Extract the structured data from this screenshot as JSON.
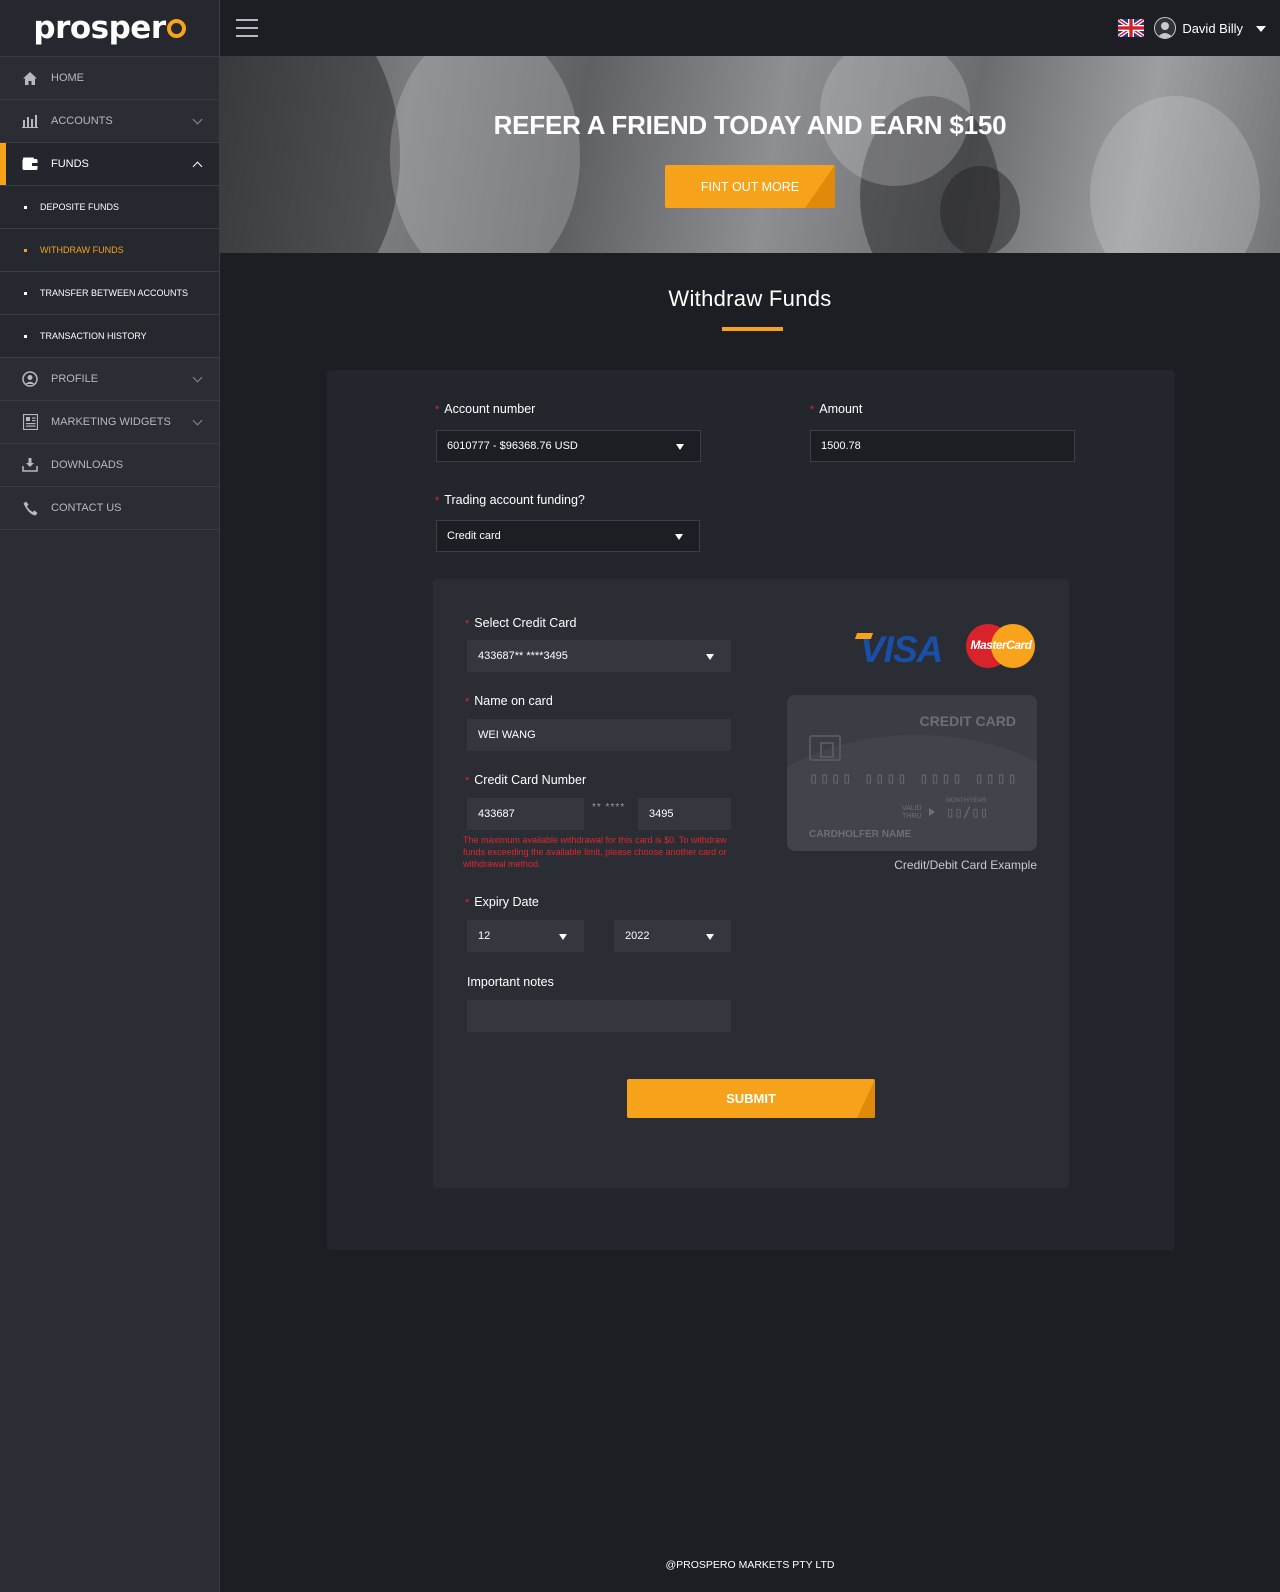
{
  "brand": {
    "logo_text": "prosper"
  },
  "sidebar": {
    "items": [
      {
        "label": "HOME",
        "icon": "home-icon"
      },
      {
        "label": "ACCOUNTS",
        "icon": "bar-chart-icon"
      },
      {
        "label": "FUNDS",
        "icon": "wallet-icon"
      },
      {
        "label": "PROFILE",
        "icon": "user-icon"
      },
      {
        "label": "MARKETING WIDGETS",
        "icon": "widgets-icon"
      },
      {
        "label": "DOWNLOADS",
        "icon": "download-icon"
      },
      {
        "label": "CONTACT US",
        "icon": "phone-icon"
      }
    ],
    "funds_sub": [
      {
        "label": "DEPOSITE FUNDS"
      },
      {
        "label": "WITHDRAW FUNDS"
      },
      {
        "label": "TRANSFER BETWEEN ACCOUNTS"
      },
      {
        "label": "TRANSACTION HISTORY"
      }
    ]
  },
  "topbar": {
    "username": "David Billy",
    "language": "uk-flag-icon"
  },
  "banner": {
    "title": "REFER A FRIEND TODAY AND EARN $150",
    "button": "FINT OUT MORE"
  },
  "page": {
    "title": "Withdraw Funds"
  },
  "form": {
    "account_number": {
      "label": "Account number",
      "value": "6010777 - $96368.76 USD"
    },
    "amount": {
      "label": "Amount",
      "value": "1500.78"
    },
    "funding": {
      "label": "Trading account funding?",
      "value": "Credit card"
    },
    "select_card": {
      "label": "Select Credit Card",
      "value": "433687** ****3495"
    },
    "name_on_card": {
      "label": "Name on card",
      "value": "WEI WANG"
    },
    "card_number": {
      "label": "Credit Card Number",
      "first": "433687",
      "middle": "** ****",
      "last": "3495"
    },
    "error": "The maximum available withdrawal for this card is $0. To withdraw funds exceeding the available limit, please choose another card or withdrawal method.",
    "expiry": {
      "label": "Expiry Date",
      "month": "12",
      "year": "2022"
    },
    "notes": {
      "label": "Important notes",
      "value": ""
    },
    "submit": "SUBMIT"
  },
  "card_example": {
    "logos": {
      "visa": "VISA",
      "mastercard": "MasterCard"
    },
    "title": "CREDIT CARD",
    "number": "▯▯▯▯ ▯▯▯▯ ▯▯▯▯ ▯▯▯▯",
    "valid_thru": "VALID THRU",
    "month_year": "MONTH/YEAR",
    "expiry": "▯▯/▯▯",
    "holder": "CARDHOLFER NAME",
    "caption": "Credit/Debit Card Example"
  },
  "footer": {
    "text": "@PROSPERO MARKETS PTY LTD"
  },
  "colors": {
    "accent": "#f7a21b",
    "error": "#e0262d",
    "background": "#1c1e23",
    "sidebar": "#2a2d34"
  }
}
